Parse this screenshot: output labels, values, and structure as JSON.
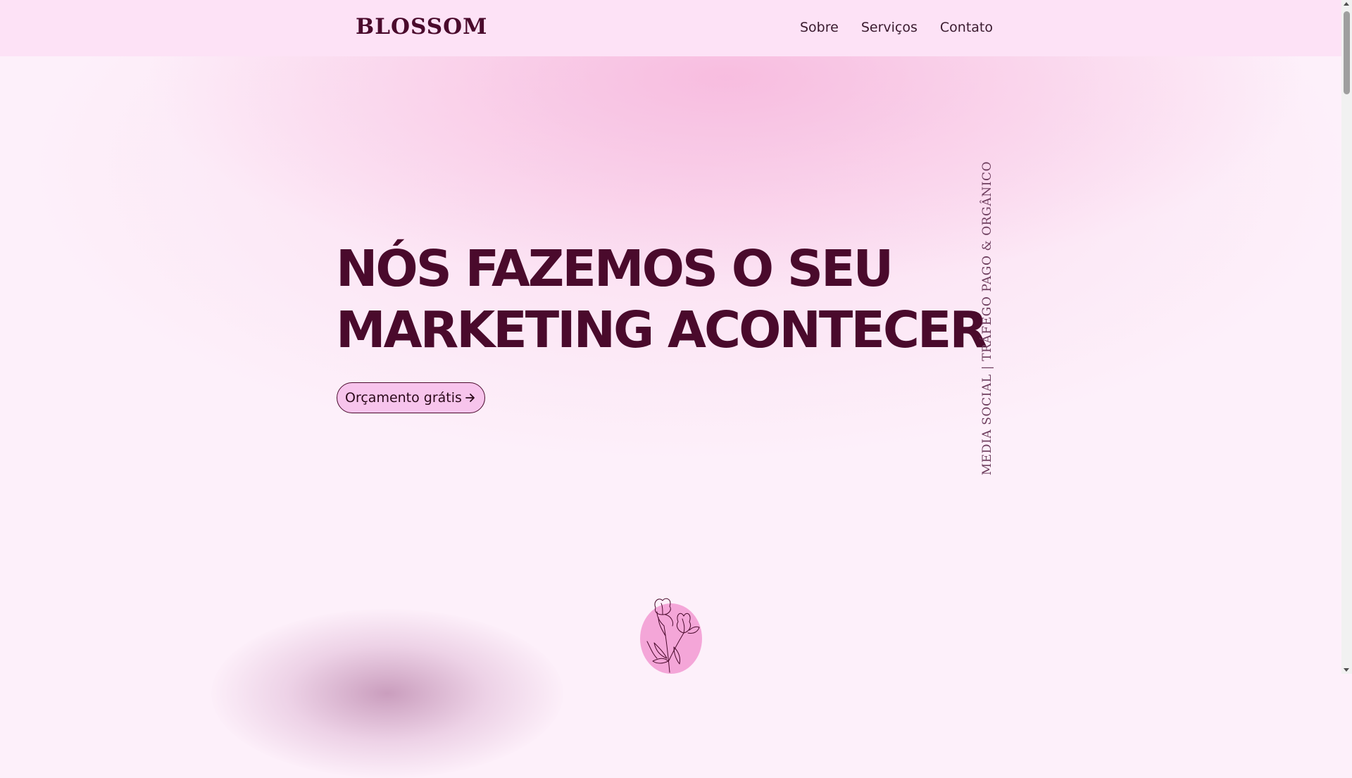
{
  "brand": {
    "logo_text": "BLOSSOM"
  },
  "nav": {
    "items": [
      "Sobre",
      "Serviços",
      "Contato"
    ]
  },
  "hero": {
    "headline_line1": "NÓS FAZEMOS O SEU",
    "headline_line2": "MARKETING ACONTECER",
    "cta_label": "Orçamento grátis",
    "vertical_tagline": "MEDIA SOCIAL | TRÁFEGO PAGO & ORGÂNICO"
  },
  "icons": {
    "cta_arrow": "arrow-right-icon",
    "flower": "flower-illustration"
  },
  "colors": {
    "primary_dark": "#4a0a2c",
    "header_bg": "#fde2f6",
    "page_bg": "#fdf0fa",
    "cta_bg": "#f7c4ec",
    "accent_pink": "#f4a6d8"
  }
}
